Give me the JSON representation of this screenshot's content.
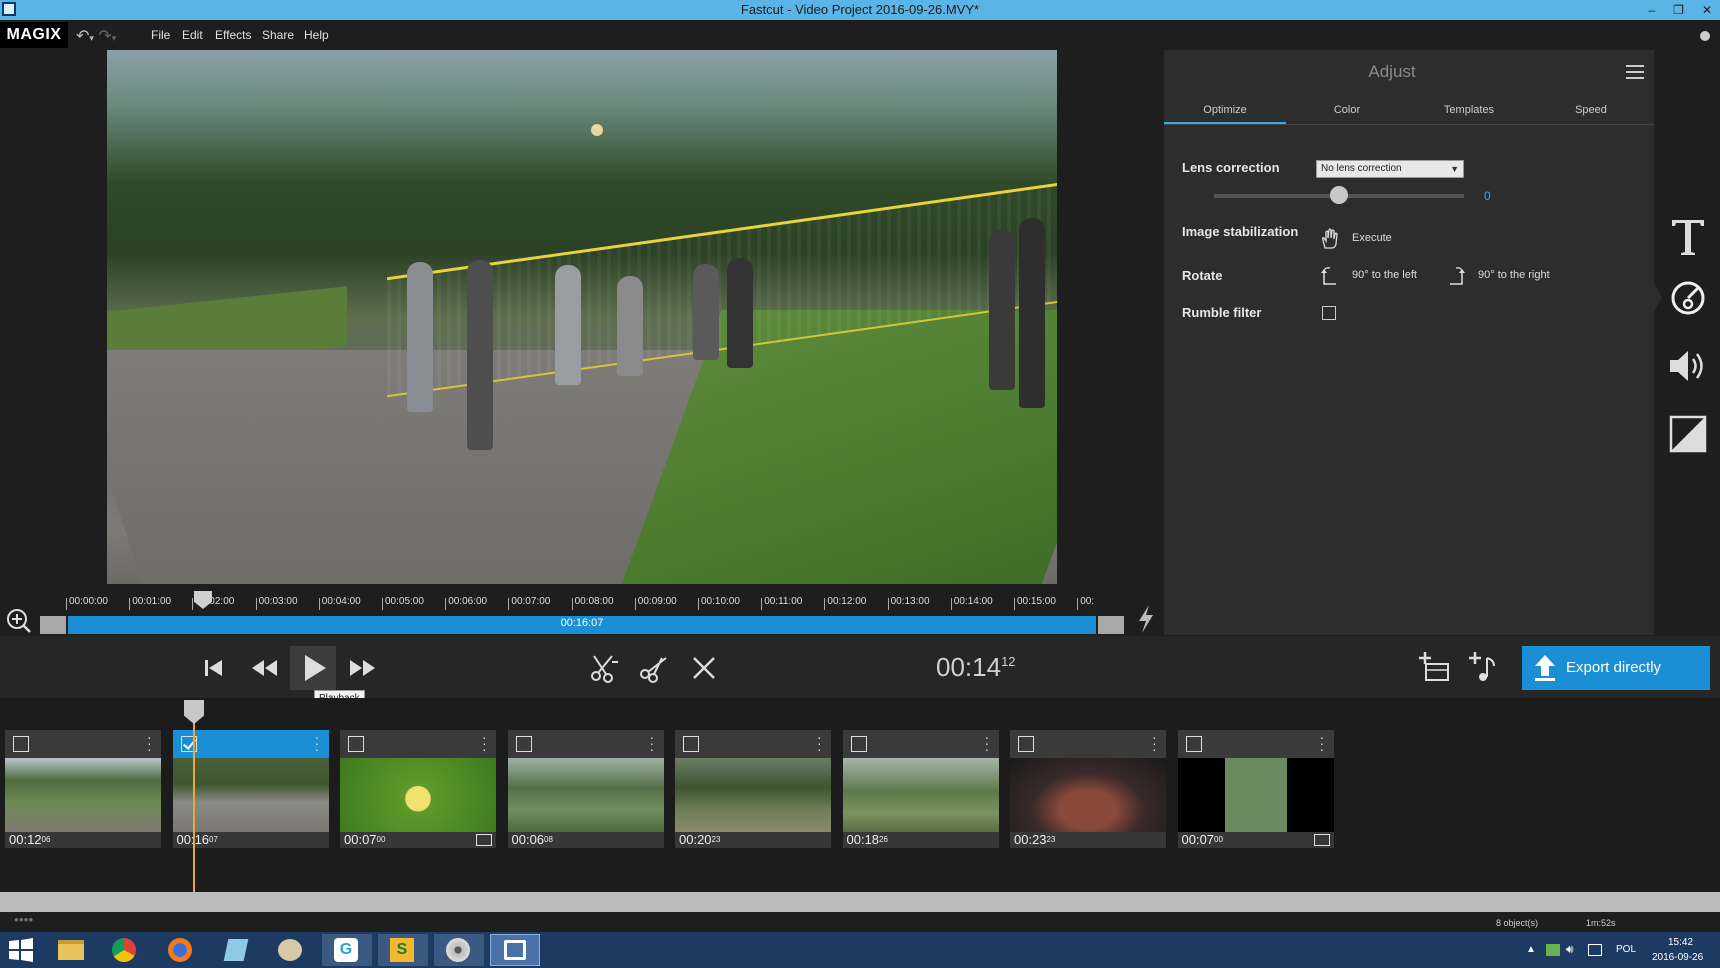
{
  "window": {
    "title": "Fastcut - Video Project 2016-09-26.MVY*",
    "controls": [
      "–",
      "❐",
      "✕"
    ]
  },
  "menubar": {
    "logo": "MAGIX",
    "items": [
      "File",
      "Edit",
      "Effects",
      "Share",
      "Help"
    ]
  },
  "preview": {
    "ruler_labels": [
      "00:00:00",
      "00:01:00",
      "00:02:00",
      "00:03:00",
      "00:04:00",
      "00:05:00",
      "00:06:00",
      "00:07:00",
      "00:08:00",
      "00:09:00",
      "00:10:00",
      "00:11:00",
      "00:12:00",
      "00:13:00",
      "00:14:00",
      "00:15:00",
      "00:"
    ],
    "progress_label": "00:16:07"
  },
  "adjust": {
    "title": "Adjust",
    "tabs": [
      "Optimize",
      "Color",
      "Templates",
      "Speed"
    ],
    "active_tab": "Optimize",
    "lens_correction": {
      "label": "Lens correction",
      "selected": "No lens correction",
      "slider_value": "0"
    },
    "image_stabilization": {
      "label": "Image stabilization",
      "action": "Execute"
    },
    "rotate": {
      "label": "Rotate",
      "left": "90° to the left",
      "right": "90° to the right"
    },
    "rumble_filter": {
      "label": "Rumble filter",
      "checked": false
    },
    "accent_color": "#3ba6e8"
  },
  "tools": [
    "text-tool-icon",
    "adjust-tool-icon",
    "audio-tool-icon",
    "transition-tool-icon"
  ],
  "transport": {
    "timecode_main": "00:14",
    "timecode_frames": "12",
    "tooltip": "Playback",
    "export_label": "Export directly"
  },
  "timeline": {
    "clips": [
      {
        "duration": "00:12",
        "frames": "06",
        "checked": false,
        "selected": false,
        "photo": false
      },
      {
        "duration": "00:16",
        "frames": "07",
        "checked": true,
        "selected": true,
        "photo": false
      },
      {
        "duration": "00:07",
        "frames": "00",
        "checked": false,
        "selected": false,
        "photo": true
      },
      {
        "duration": "00:06",
        "frames": "08",
        "checked": false,
        "selected": false,
        "photo": false
      },
      {
        "duration": "00:20",
        "frames": "23",
        "checked": false,
        "selected": false,
        "photo": false
      },
      {
        "duration": "00:18",
        "frames": "26",
        "checked": false,
        "selected": false,
        "photo": false
      },
      {
        "duration": "00:23",
        "frames": "23",
        "checked": false,
        "selected": false,
        "photo": false
      },
      {
        "duration": "00:07",
        "frames": "00",
        "checked": false,
        "selected": false,
        "photo": true
      }
    ]
  },
  "status": {
    "objects": "8 object(s)",
    "total": "1m:52s"
  },
  "taskbar": {
    "tray_lang": "POL",
    "time": "15:42",
    "date": "2016-09-26"
  }
}
